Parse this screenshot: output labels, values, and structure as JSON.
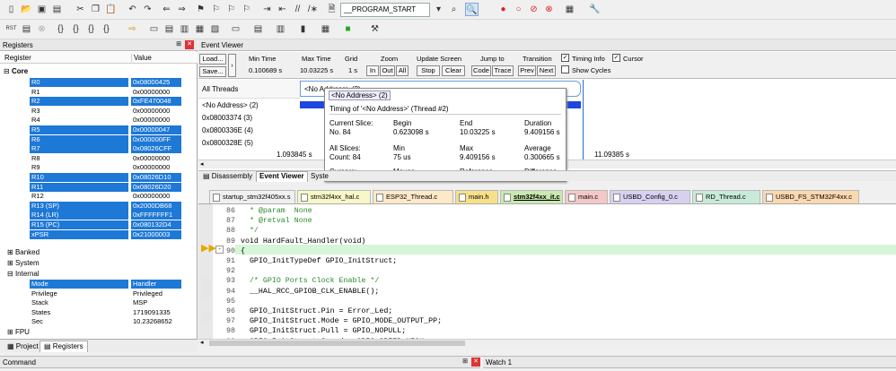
{
  "toolbar": {
    "target_combo": "__PROGRAM_START"
  },
  "registers_panel": {
    "title": "Registers",
    "col_register": "Register",
    "col_value": "Value",
    "groups": {
      "core": "Core",
      "banked": "Banked",
      "system": "System",
      "internal": "Internal",
      "fpu": "FPU"
    },
    "core": [
      {
        "name": "R0",
        "value": "0x08000425",
        "sel": true
      },
      {
        "name": "R1",
        "value": "0x00000000",
        "sel": false
      },
      {
        "name": "R2",
        "value": "0xFE470048",
        "sel": true
      },
      {
        "name": "R3",
        "value": "0x00000000",
        "sel": false
      },
      {
        "name": "R4",
        "value": "0x00000000",
        "sel": false
      },
      {
        "name": "R5",
        "value": "0x00000047",
        "sel": true
      },
      {
        "name": "R6",
        "value": "0x000000FF",
        "sel": true
      },
      {
        "name": "R7",
        "value": "0x08026CFF",
        "sel": true
      },
      {
        "name": "R8",
        "value": "0x00000000",
        "sel": false
      },
      {
        "name": "R9",
        "value": "0x00000000",
        "sel": false
      },
      {
        "name": "R10",
        "value": "0x08026D10",
        "sel": true
      },
      {
        "name": "R11",
        "value": "0x08026D20",
        "sel": true
      },
      {
        "name": "R12",
        "value": "0x00000000",
        "sel": false
      },
      {
        "name": "R13 (SP)",
        "value": "0x2000DB68",
        "sel": true
      },
      {
        "name": "R14 (LR)",
        "value": "0xFFFFFFF1",
        "sel": true
      },
      {
        "name": "R15 (PC)",
        "value": "0x080132D4",
        "sel": true
      },
      {
        "name": "xPSR",
        "value": "0x21000003",
        "sel": true
      }
    ],
    "internal": [
      {
        "name": "Mode",
        "value": "Handler",
        "sel": true
      },
      {
        "name": "Privilege",
        "value": "Privileged",
        "sel": false
      },
      {
        "name": "Stack",
        "value": "MSP",
        "sel": false
      },
      {
        "name": "States",
        "value": "1719091335",
        "sel": false
      },
      {
        "name": "Sec",
        "value": "10.23268652",
        "sel": false
      }
    ],
    "tab_project": "Project",
    "tab_registers": "Registers"
  },
  "event_viewer": {
    "title": "Event Viewer",
    "load": "Load...",
    "save": "Save...",
    "min_time_label": "Min Time",
    "min_time": "0.100689 s",
    "max_time_label": "Max Time",
    "max_time": "10.03225 s",
    "grid_label": "Grid",
    "grid": "1 s",
    "zoom_label": "Zoom",
    "zoom_in": "In",
    "zoom_out": "Out",
    "zoom_all": "All",
    "update_label": "Update Screen",
    "stop": "Stop",
    "clear": "Clear",
    "jump_label": "Jump to",
    "code": "Code",
    "trace": "Trace",
    "transition_label": "Transition",
    "prev": "Prev",
    "next": "Next",
    "timing_info": "Timing Info",
    "cursor": "Cursor",
    "show_cycles": "Show Cycles",
    "rows": [
      "All Threads",
      "<No Address> (2)",
      "0x08003374 (3)",
      "0x0800336E (4)",
      "0x0800328E (5)"
    ],
    "bar_label": "<No Address> (2)",
    "time_left": "1.093845 s",
    "time_right": "11.09385 s",
    "tooltip": {
      "tag": "<No Address> (2)",
      "title": "Timing of '<No Address>' (Thread #2)",
      "current_slice": "Current Slice:",
      "no": "No. 84",
      "begin_label": "Begin",
      "begin": "0.623098 s",
      "end_label": "End",
      "end": "10.03225 s",
      "duration_label": "Duration",
      "duration": "9.409156 s",
      "all_slices": "All Slices:",
      "count": "Count: 84",
      "min_label": "Min",
      "min": "75 us",
      "max_label": "Max",
      "max": "9.409156 s",
      "avg_label": "Average",
      "avg": "0.300665 s",
      "cursors": "Cursors:",
      "mouse_label": "Mouse",
      "mouse": "1.953845 s",
      "ref_label": "Reference",
      "ref": "N/A",
      "diff_label": "Difference",
      "diff": "N/A"
    }
  },
  "view_tabs": [
    "Disassembly",
    "Event Viewer",
    "Syste"
  ],
  "file_tabs": [
    {
      "label": "startup_stm32f405xx.s",
      "color": "#f0f0f0"
    },
    {
      "label": "stm32f4xx_hal.c",
      "color": "#f7f7c8"
    },
    {
      "label": "ESP32_Thread.c",
      "color": "#fde8c8"
    },
    {
      "label": "main.h",
      "color": "#f7e08a"
    },
    {
      "label": "stm32f4xx_it.c",
      "color": "#c9e8b2"
    },
    {
      "label": "main.c",
      "color": "#f5c8c8"
    },
    {
      "label": "USBD_Config_0.c",
      "color": "#d8d0f0"
    },
    {
      "label": "RD_Thread.c",
      "color": "#c8ead8"
    },
    {
      "label": "USBD_FS_STM32F4xx.c",
      "color": "#fad8b0"
    }
  ],
  "code": [
    {
      "n": "86",
      "t": "  * @param  None",
      "c": "cm"
    },
    {
      "n": "87",
      "t": "  * @retval None",
      "c": "cm"
    },
    {
      "n": "88",
      "t": "  */",
      "c": "cm"
    },
    {
      "n": "89",
      "t": "void HardFault_Handler(void)",
      "c": ""
    },
    {
      "n": "90",
      "t": "{",
      "c": ""
    },
    {
      "n": "91",
      "t": "  GPIO_InitTypeDef GPIO_InitStruct;",
      "c": ""
    },
    {
      "n": "92",
      "t": "",
      "c": ""
    },
    {
      "n": "93",
      "t": "  /* GPIO Ports Clock Enable */",
      "c": "cm"
    },
    {
      "n": "94",
      "t": "  __HAL_RCC_GPIOB_CLK_ENABLE();",
      "c": ""
    },
    {
      "n": "95",
      "t": "",
      "c": ""
    },
    {
      "n": "96",
      "t": "  GPIO_InitStruct.Pin = Error_Led;",
      "c": ""
    },
    {
      "n": "97",
      "t": "  GPIO_InitStruct.Mode = GPIO_MODE_OUTPUT_PP;",
      "c": ""
    },
    {
      "n": "98",
      "t": "  GPIO_InitStruct.Pull = GPIO_NOPULL;",
      "c": ""
    },
    {
      "n": "99",
      "t": "  GPIO_InitStruct.Speed = GPIO_SPEED_HIGH;",
      "c": ""
    }
  ],
  "bottom": {
    "command": "Command",
    "watch": "Watch 1"
  }
}
